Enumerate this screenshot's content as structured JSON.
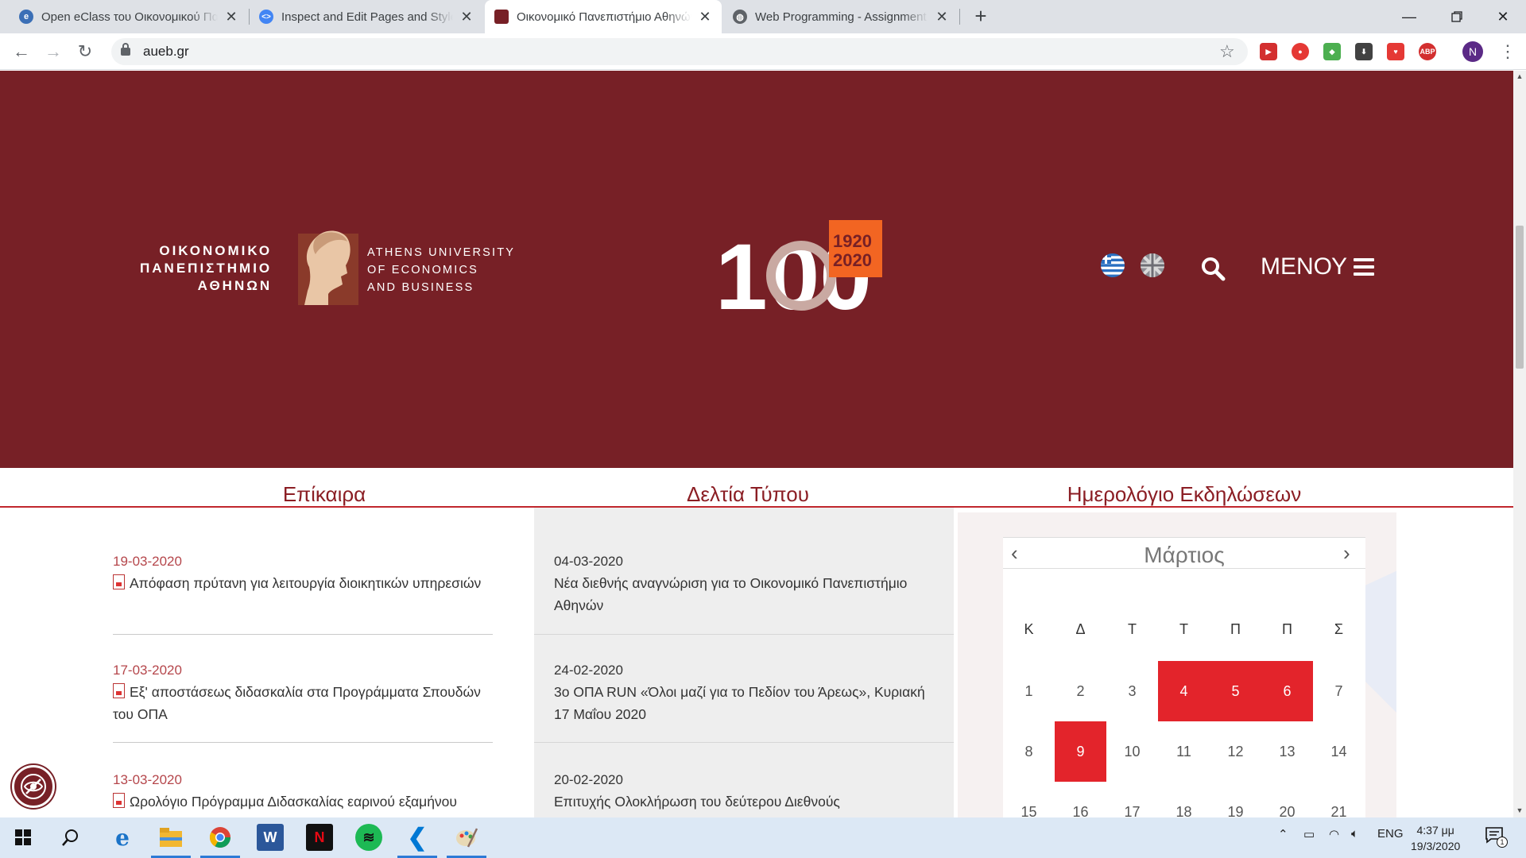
{
  "browser": {
    "tabs": [
      {
        "title": "Open eClass του Οικονομικού Πανεπιστημίου Αθηνών",
        "icon": "eclass-icon",
        "active": false
      },
      {
        "title": "Inspect and Edit Pages and Styles",
        "icon": "devtools-icon",
        "active": false
      },
      {
        "title": "Οικονομικό Πανεπιστήμιο Αθηνών",
        "icon": "aueb-icon",
        "active": true
      },
      {
        "title": "Web Programming - Assignment",
        "icon": "globe-icon",
        "active": false
      }
    ],
    "url": "aueb.gr",
    "profile_initial": "N",
    "extensions": [
      "ABP"
    ]
  },
  "site": {
    "logo": {
      "greek_lines": [
        "ΟΙΚΟΝΟΜΙΚΟ",
        "ΠΑΝΕΠΙΣΤΗΜΙΟ",
        "ΑΘΗΝΩΝ"
      ],
      "english_lines": [
        "ATHENS UNIVERSITY",
        "OF ECONOMICS",
        "AND BUSINESS"
      ]
    },
    "anniversary": {
      "number": "100",
      "years_top": "1920",
      "years_bottom": "2020"
    },
    "menu_label": "ΜΕΝΟΥ",
    "colors": {
      "brand": "#772026",
      "accent": "#c0272d",
      "event": "#e3242b",
      "badge": "#f26522"
    }
  },
  "sections": {
    "news_title": "Επίκαιρα",
    "press_title": "Δελτία Τύπου",
    "calendar_title": "Ημερολόγιο Εκδηλώσεων"
  },
  "news": [
    {
      "date": "19-03-2020",
      "text": "Απόφαση πρύτανη για λειτουργία διοικητικών υπηρεσιών"
    },
    {
      "date": "17-03-2020",
      "text": "Εξ' αποστάσεως διδασκαλία στα Προγράμματα Σπουδών του ΟΠΑ"
    },
    {
      "date": "13-03-2020",
      "text": "Ωρολόγιο Πρόγραμμα Διδασκαλίας εαρινού εξαμήνου"
    }
  ],
  "press": [
    {
      "date": "04-03-2020",
      "text": "Νέα διεθνής αναγνώριση για το Οικονομικό Πανεπιστήμιο Αθηνών"
    },
    {
      "date": "24-02-2020",
      "text": "3ο ΟΠΑ RUN «Όλοι μαζί για το Πεδίον του Άρεως», Κυριακή 17 Μαΐου 2020"
    },
    {
      "date": "20-02-2020",
      "text": "Επιτυχής Ολοκλήρωση του δεύτερου Διεθνούς"
    }
  ],
  "calendar": {
    "month": "Μάρτιος",
    "weekdays": [
      "Κ",
      "Δ",
      "Τ",
      "Τ",
      "Π",
      "Π",
      "Σ"
    ],
    "week1": [
      "1",
      "2",
      "3",
      "4",
      "5",
      "6",
      "7"
    ],
    "week2": [
      "8",
      "9",
      "10",
      "11",
      "12",
      "13",
      "14"
    ],
    "week3": [
      "15",
      "16",
      "17",
      "18",
      "19",
      "20",
      "21"
    ],
    "event_days": [
      "4",
      "5",
      "6",
      "9"
    ]
  },
  "taskbar": {
    "language": "ENG",
    "time": "4:37 μμ",
    "date": "19/3/2020",
    "notifications": "1",
    "apps": [
      "start-icon",
      "search-icon",
      "edge-icon",
      "file-explorer-icon",
      "chrome-icon",
      "word-icon",
      "netflix-icon",
      "spotify-icon",
      "vscode-icon",
      "paint-icon"
    ]
  }
}
